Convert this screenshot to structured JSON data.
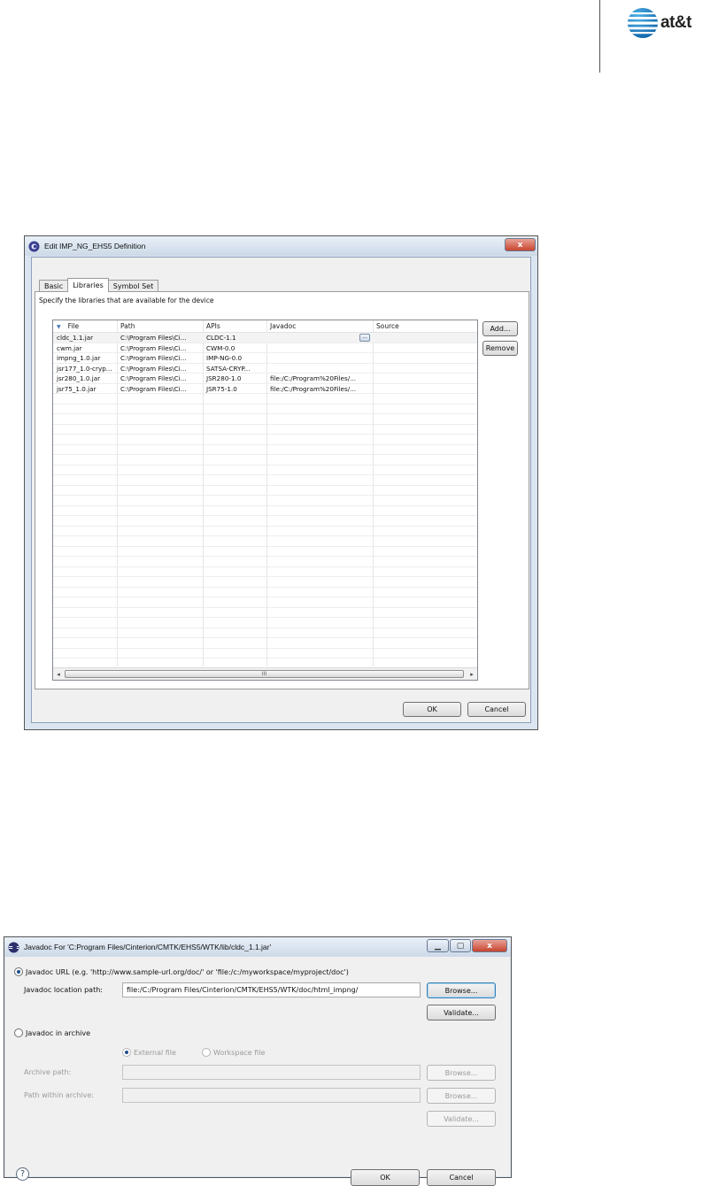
{
  "header": {
    "logo_text": "at&t"
  },
  "edit_window": {
    "title": "Edit IMP_NG_EHS5 Definition",
    "close_glyph": "x",
    "tabs": [
      "Basic",
      "Libraries",
      "Symbol Set"
    ],
    "active_tab": "Libraries",
    "hint": "Specify the libraries that are available for the device",
    "columns": [
      "File",
      "Path",
      "APIs",
      "Javadoc",
      "Source"
    ],
    "rows": [
      {
        "file": "cldc_1.1.jar",
        "path": "C:\\Program Files\\Ci...",
        "apis": "CLDC-1.1",
        "javadoc": "",
        "source": ""
      },
      {
        "file": "cwm.jar",
        "path": "C:\\Program Files\\Ci...",
        "apis": "CWM-0.0",
        "javadoc": "",
        "source": ""
      },
      {
        "file": "impng_1.0.jar",
        "path": "C:\\Program Files\\Ci...",
        "apis": "IMP-NG-0.0",
        "javadoc": "",
        "source": ""
      },
      {
        "file": "jsr177_1.0-cryp...",
        "path": "C:\\Program Files\\Ci...",
        "apis": "SATSA-CRYP...",
        "javadoc": "",
        "source": ""
      },
      {
        "file": "jsr280_1.0.jar",
        "path": "C:\\Program Files\\Ci...",
        "apis": "JSR280-1.0",
        "javadoc": "file:/C:/Program%20Files/...",
        "source": ""
      },
      {
        "file": "jsr75_1.0.jar",
        "path": "C:\\Program Files\\Ci...",
        "apis": "JSR75-1.0",
        "javadoc": "file:/C:/Program%20Files/...",
        "source": ""
      }
    ],
    "ellipsis_label": "...",
    "scroll_grip": "III",
    "add_label": "Add...",
    "remove_label": "Remove",
    "ok_label": "OK",
    "cancel_label": "Cancel"
  },
  "javadoc_window": {
    "title": "Javadoc For 'C:Program Files/Cinterion/CMTK/EHS5/WTK/lib/cldc_1.1.jar'",
    "url_radio_label": "Javadoc URL (e.g. 'http://www.sample-url.org/doc/' or 'file:/c:/myworkspace/myproject/doc')",
    "location_label": "Javadoc location path:",
    "location_value": "file:/C:/Program Files/Cinterion/CMTK/EHS5/WTK/doc/html_impng/",
    "browse_label": "Browse...",
    "validate_label": "Validate...",
    "archive_radio_label": "Javadoc in archive",
    "external_file_label": "External file",
    "workspace_file_label": "Workspace file",
    "archive_path_label": "Archive path:",
    "path_within_label": "Path within archive:",
    "help_glyph": "?",
    "ok_label": "OK",
    "cancel_label": "Cancel"
  }
}
